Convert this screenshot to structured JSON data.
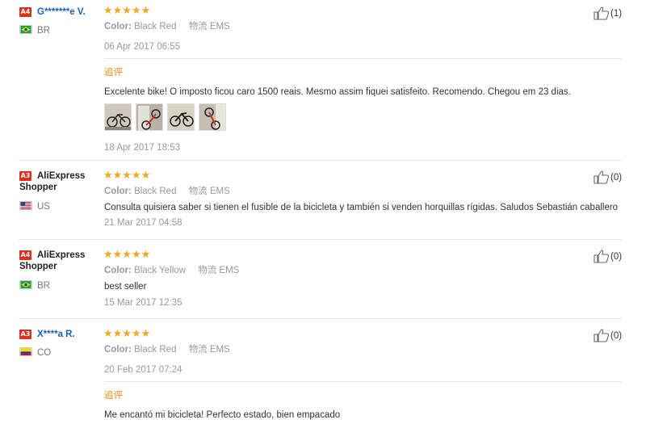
{
  "reviews": [
    {
      "badge": "A4",
      "user": "G*******e V.",
      "country": "BR",
      "stars": "★★★★★",
      "color_label": "Color:",
      "color_value": "Black Red",
      "logistics_label": "物流",
      "logistics_value": "EMS",
      "date": "06 Apr 2017 06:55",
      "likes": "(1)",
      "additional_label": "追评",
      "additional_text": "Excelente bike! O imposto ficou caro 1500 reais. Mesmo assim fiquei satisfeito. Recomendo. Chegou em 23 dias.",
      "additional_date": "18 Apr 2017 18:53"
    },
    {
      "badge": "A3",
      "user_line1": "AliExpress",
      "user_line2": "Shopper",
      "country": "US",
      "stars": "★★★★★",
      "color_label": "Color:",
      "color_value": "Black Red",
      "logistics_label": "物流",
      "logistics_value": "EMS",
      "text": "Consulta quisiera saber si tienen el fusible de la bicicleta y también si venden horquillas rígidas. Saludos Sebastián caballero",
      "date": "21 Mar 2017 04:58",
      "likes": "(0)"
    },
    {
      "badge": "A4",
      "user_line1": "AliExpress",
      "user_line2": "Shopper",
      "country": "BR",
      "stars": "★★★★★",
      "color_label": "Color:",
      "color_value": "Black Yellow",
      "logistics_label": "物流",
      "logistics_value": "EMS",
      "text": "best seller",
      "date": "15 Mar 2017 12:35",
      "likes": "(0)"
    },
    {
      "badge": "A3",
      "user": "X****a R.",
      "country": "CO",
      "stars": "★★★★★",
      "color_label": "Color:",
      "color_value": "Black Red",
      "logistics_label": "物流",
      "logistics_value": "EMS",
      "date": "20 Feb 2017 07:24",
      "likes": "(0)",
      "additional_label": "追评",
      "additional_text": "Me encantó mi bicicleta! Perfecto estado, bien empacado"
    }
  ],
  "colors": {
    "star": "#f5a623",
    "badge": "#e02f1f",
    "link": "#1a5fb4",
    "additional": "#e38c16"
  }
}
